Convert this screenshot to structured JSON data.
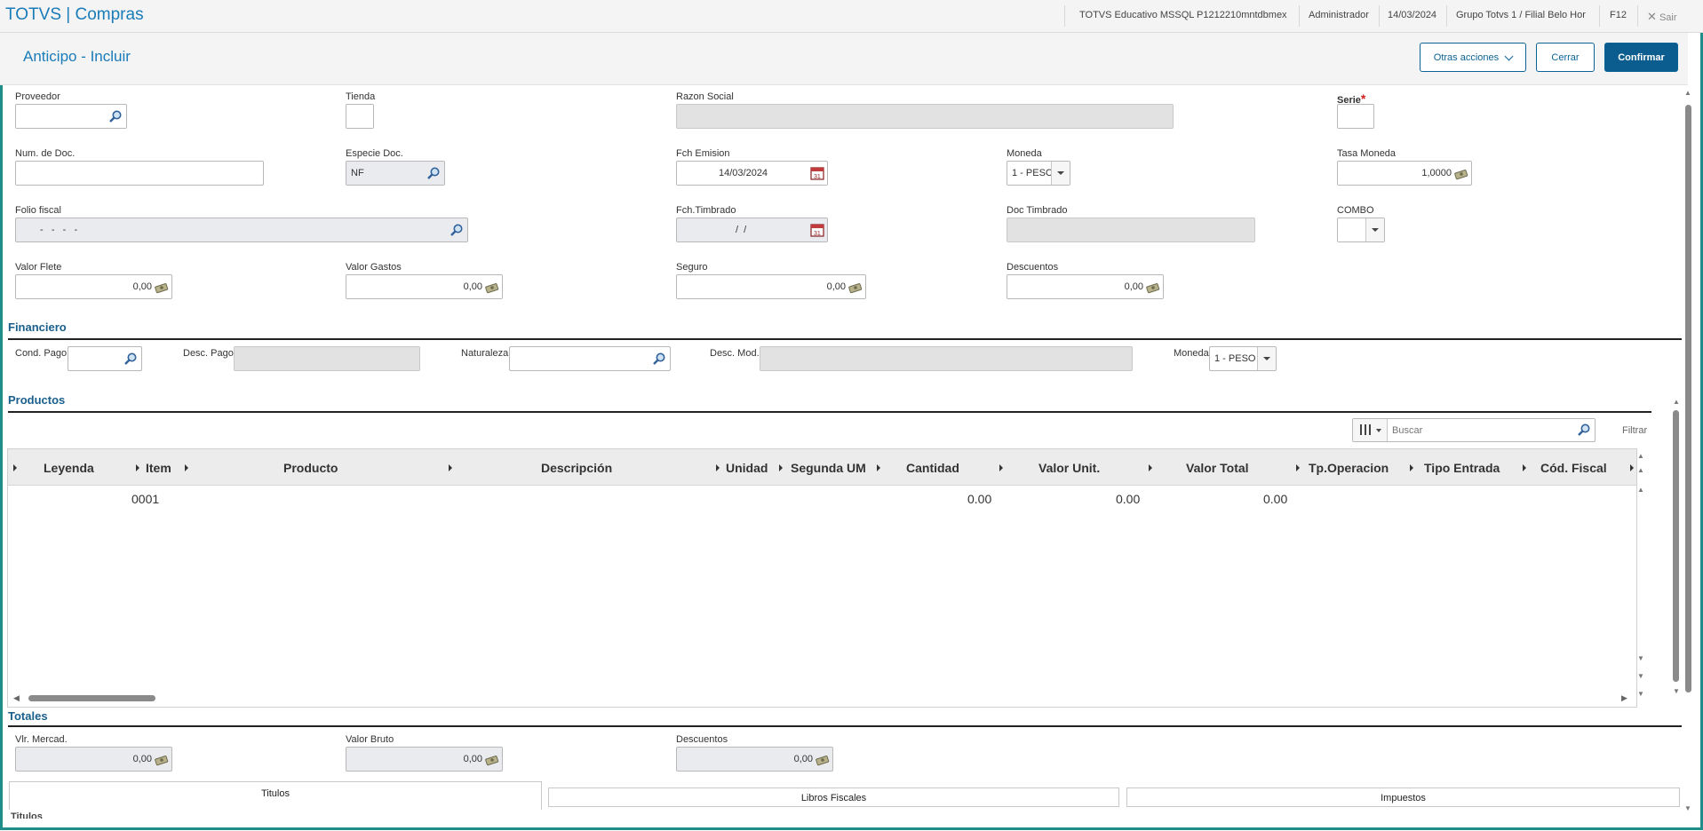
{
  "topbar": {
    "app_title": "TOTVS | Compras",
    "environment": "TOTVS Educativo MSSQL P1212210mntdbmex",
    "user": "Administrador",
    "date": "14/03/2024",
    "branch": "Grupo Totvs 1 / Filial Belo Hor",
    "f12": "F12",
    "exit": "Sair"
  },
  "header": {
    "title": "Anticipo - Incluir",
    "more_actions": "Otras acciones",
    "close": "Cerrar",
    "confirm": "Confirmar"
  },
  "form": {
    "proveedor": {
      "label": "Proveedor",
      "value": ""
    },
    "tienda": {
      "label": "Tienda",
      "value": ""
    },
    "razon_social": {
      "label": "Razon Social",
      "value": ""
    },
    "serie": {
      "label": "Serie",
      "value": ""
    },
    "num_doc": {
      "label": "Num. de Doc.",
      "value": ""
    },
    "especie_doc": {
      "label": "Especie Doc.",
      "value": "NF"
    },
    "fch_emision": {
      "label": "Fch Emision",
      "value": "14/03/2024"
    },
    "moneda": {
      "label": "Moneda",
      "value": "1 - PESC"
    },
    "tasa_moneda": {
      "label": "Tasa Moneda",
      "value": "1,0000"
    },
    "folio_fiscal": {
      "label": "Folio fiscal",
      "value": "-   -   -   -"
    },
    "fch_timbrado": {
      "label": "Fch.Timbrado",
      "value": "/  /"
    },
    "doc_timbrado": {
      "label": "Doc Timbrado",
      "value": ""
    },
    "combo": {
      "label": "COMBO",
      "value": ""
    },
    "valor_flete": {
      "label": "Valor Flete",
      "value": "0,00"
    },
    "valor_gastos": {
      "label": "Valor Gastos",
      "value": "0,00"
    },
    "seguro": {
      "label": "Seguro",
      "value": "0,00"
    },
    "descuentos": {
      "label": "Descuentos",
      "value": "0,00"
    }
  },
  "financiero": {
    "title": "Financiero",
    "cond_pago": {
      "label": "Cond. Pago",
      "value": ""
    },
    "desc_pago": {
      "label": "Desc. Pago",
      "value": ""
    },
    "naturaleza": {
      "label": "Naturaleza",
      "value": ""
    },
    "desc_mod": {
      "label": "Desc. Mod.",
      "value": ""
    },
    "moneda": {
      "label": "Moneda",
      "value": "1 - PESO"
    }
  },
  "productos": {
    "title": "Productos",
    "search_placeholder": "Buscar",
    "filter": "Filtrar",
    "columns": [
      "Leyenda",
      "Item",
      "Producto",
      "Descripción",
      "Unidad",
      "Segunda UM",
      "Cantidad",
      "Valor Unit.",
      "Valor Total",
      "Tp.Operacion",
      "Tipo Entrada",
      "Cód. Fiscal"
    ],
    "rows": [
      {
        "item": "0001",
        "cantidad": "0.00",
        "valor_unit": "0.00",
        "valor_total": "0.00"
      }
    ]
  },
  "totales": {
    "title": "Totales",
    "vlr_mercad": {
      "label": "Vlr. Mercad.",
      "value": "0,00"
    },
    "valor_bruto": {
      "label": "Valor Bruto",
      "value": "0,00"
    },
    "descuentos": {
      "label": "Descuentos",
      "value": "0,00"
    }
  },
  "tabs": [
    "Titulos",
    "Libros Fiscales",
    "Impuestos"
  ],
  "partial_section": "Titulos"
}
